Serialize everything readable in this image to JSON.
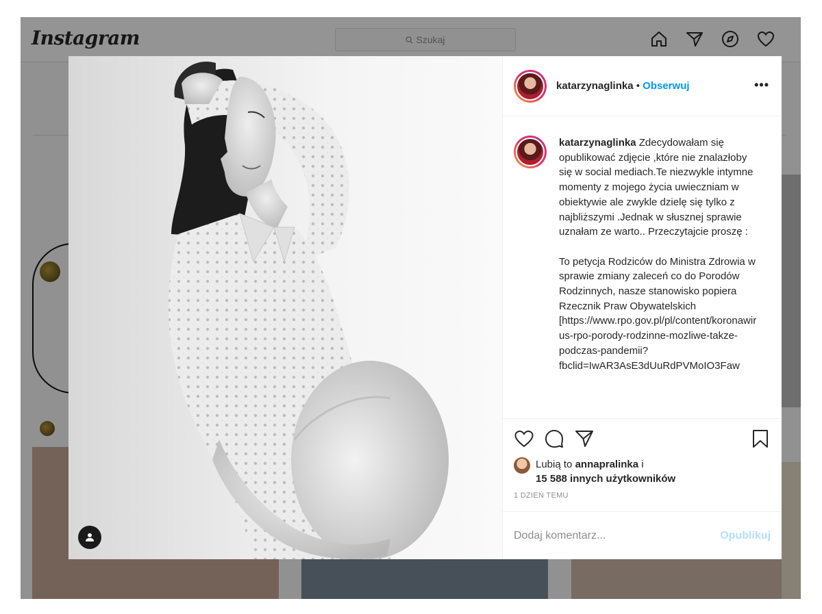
{
  "app": {
    "logo": "Instagram"
  },
  "search": {
    "placeholder": "Szukaj"
  },
  "post": {
    "username": "katarzynaglinka",
    "separator": "•",
    "follow_label": "Obserwuj",
    "more_label": "•••",
    "caption_username": "katarzynaglinka",
    "caption": "Zdecydowałam się opublikować zdjęcie ,które nie znalazłoby się w social mediach.Te niezwykle intymne momenty z mojego życia uwieczniam w obiektywie ale zwykle dzielę się tylko z najbliższymi .Jednak w słusznej sprawie uznałam ze warto.. Przeczytajcie proszę :\n\nTo petycja Rodziców do Ministra Zdrowia w sprawie zmiany zaleceń co do Porodów Rodzinnych, nasze stanowisko popiera Rzecznik Praw Obywatelskich [https://www.rpo.gov.pl/pl/content/koronawirus-rpo-porody-rodzinne-mozliwe-takze-podczas-pandemii?fbclid=IwAR3AsE3dUuRdPVMoIO3Faw",
    "likes_prefix": "Lubią to",
    "likes_user": "annapralinka",
    "likes_and": "i",
    "likes_count": "15 588 innych użytkowników",
    "time": "1 DZIEŃ TEMU",
    "comment_placeholder": "Dodaj komentarz...",
    "publish_label": "Opublikuj"
  }
}
